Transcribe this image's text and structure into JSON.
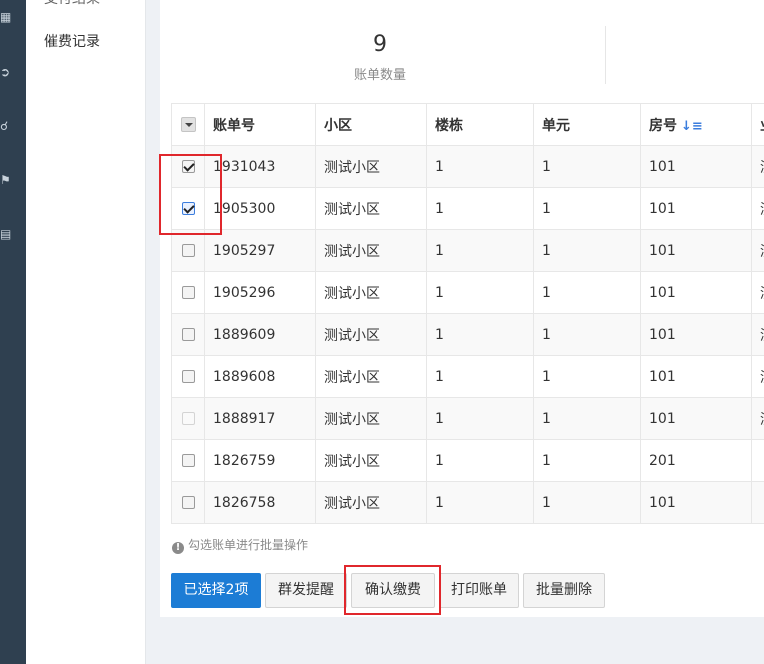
{
  "sidebar": {
    "icons": [
      "grid-icon",
      "exit-icon",
      "share-icon",
      "bank-icon",
      "document-icon"
    ],
    "items": [
      {
        "label": "支付结果"
      },
      {
        "label": "催费记录"
      }
    ]
  },
  "stats": {
    "bill_count": "9",
    "bill_count_label": "账单数量"
  },
  "table": {
    "headers": {
      "bill_no": "账单号",
      "community": "小区",
      "building": "楼栋",
      "unit": "单元",
      "room": "房号",
      "more": "业"
    },
    "rows": [
      {
        "bill_no": "1931043",
        "community": "测试小区",
        "building": "1",
        "unit": "1",
        "room": "101",
        "more": "测",
        "checked": true
      },
      {
        "bill_no": "1905300",
        "community": "测试小区",
        "building": "1",
        "unit": "1",
        "room": "101",
        "more": "测",
        "checked": true
      },
      {
        "bill_no": "1905297",
        "community": "测试小区",
        "building": "1",
        "unit": "1",
        "room": "101",
        "more": "测",
        "checked": false
      },
      {
        "bill_no": "1905296",
        "community": "测试小区",
        "building": "1",
        "unit": "1",
        "room": "101",
        "more": "测",
        "checked": false
      },
      {
        "bill_no": "1889609",
        "community": "测试小区",
        "building": "1",
        "unit": "1",
        "room": "101",
        "more": "测",
        "checked": false
      },
      {
        "bill_no": "1889608",
        "community": "测试小区",
        "building": "1",
        "unit": "1",
        "room": "101",
        "more": "测",
        "checked": false
      },
      {
        "bill_no": "1888917",
        "community": "测试小区",
        "building": "1",
        "unit": "1",
        "room": "101",
        "more": "测",
        "checked": false
      },
      {
        "bill_no": "1826759",
        "community": "测试小区",
        "building": "1",
        "unit": "1",
        "room": "201",
        "more": "",
        "checked": false
      },
      {
        "bill_no": "1826758",
        "community": "测试小区",
        "building": "1",
        "unit": "1",
        "room": "101",
        "more": "",
        "checked": false
      }
    ]
  },
  "hint": {
    "text": "勾选账单进行批量操作"
  },
  "actions": {
    "selected": "已选择2项",
    "mass_remind": "群发提醒",
    "confirm_payment": "确认缴费",
    "print_bill": "打印账单",
    "batch_delete": "批量删除"
  },
  "colors": {
    "primary": "#1c7cd5",
    "sidebar_dark": "#2f4050",
    "highlight_red": "#e0272c",
    "sort_blue": "#3b7ddd"
  }
}
